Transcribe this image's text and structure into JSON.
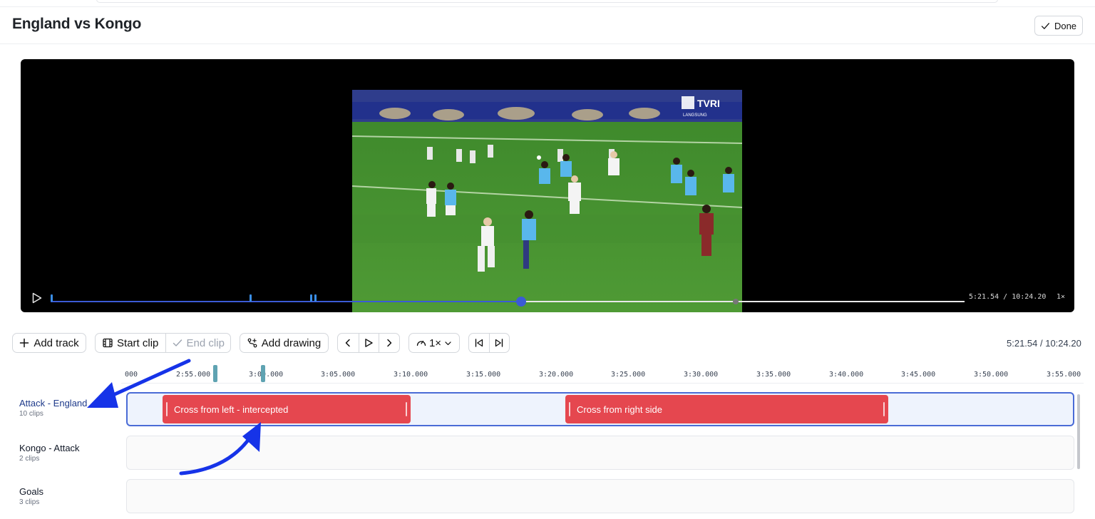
{
  "header": {
    "title": "England vs Kongo",
    "done_label": "Done"
  },
  "video": {
    "time": "5:21.54 / 10:24.20",
    "speed": "1×",
    "progress": 0.515,
    "marker_positions": [
      0.0,
      0.218,
      0.284,
      0.289
    ],
    "broadcaster_logo": "TVRI",
    "broadcast_caption": "LANGSUNG"
  },
  "toolbar": {
    "add_track": "Add track",
    "start_clip": "Start clip",
    "end_clip": "End clip",
    "add_drawing": "Add drawing",
    "speed": "1×",
    "time": "5:21.54 / 10:24.20"
  },
  "ruler": {
    "ticks": [
      "000",
      "2:55.000",
      "3:00.000",
      "3:05.000",
      "3:10.000",
      "3:15.000",
      "3:20.000",
      "3:25.000",
      "3:30.000",
      "3:35.000",
      "3:40.000",
      "3:45.000",
      "3:50.000",
      "3:55.000"
    ]
  },
  "tracks": [
    {
      "name": "Attack - England",
      "count": "10 clips",
      "active": true
    },
    {
      "name": "Kongo - Attack",
      "count": "2 clips",
      "active": false
    },
    {
      "name": "Goals",
      "count": "3 clips",
      "active": false
    }
  ],
  "clips": [
    {
      "label": "Cross from left - intercepted",
      "track": 0
    },
    {
      "label": "Cross from right side",
      "track": 0
    }
  ],
  "colors": {
    "accent": "#3b5bd6",
    "clip": "#e5474f",
    "active_lane_bg": "#eef3fd",
    "annotation_arrow": "#1633e8"
  }
}
